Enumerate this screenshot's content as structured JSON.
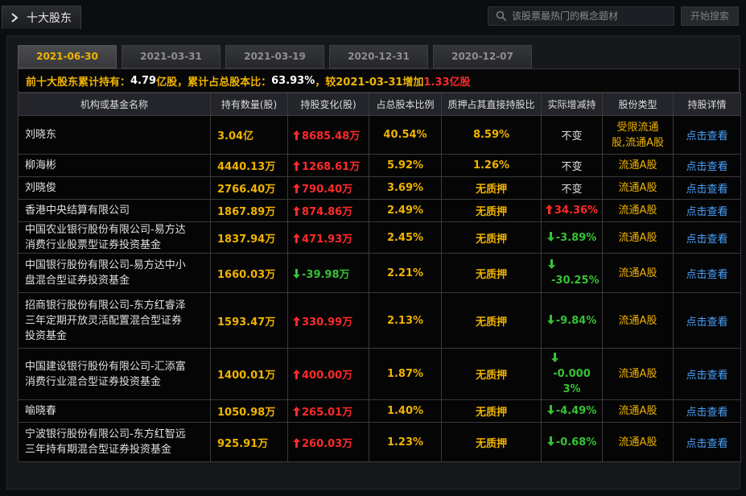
{
  "header": {
    "title": "十大股东",
    "search_placeholder": "该股票最热门的概念题材",
    "search_button": "开始搜索"
  },
  "tabs": [
    "2021-06-30",
    "2021-03-31",
    "2021-03-19",
    "2020-12-31",
    "2020-12-07"
  ],
  "active_tab": 0,
  "summary": {
    "prefix": "前十大股东累计持有：",
    "holding": "4.79",
    "holding_unit": "亿股，累计占总股本比：",
    "ratio": "63.93%",
    "compare": "，较2021-03-31增加",
    "increase": "1.33亿股"
  },
  "columns": [
    "机构或基金名称",
    "持有数量(股)",
    "持股变化(股)",
    "占总股本比例",
    "质押占其直接持股比",
    "实际增减持",
    "股份类型",
    "持股详情"
  ],
  "rows": [
    {
      "name_lines": [
        "刘晓东"
      ],
      "qty": "3.04亿",
      "change": "8685.48万",
      "change_dir": "up",
      "pct": "40.54%",
      "pledge": "8.59%",
      "actual": "不变",
      "actual_dir": "none",
      "type_lines": [
        "受限流通",
        "股,流通A股"
      ],
      "detail": "点击查看"
    },
    {
      "name_lines": [
        "柳海彬"
      ],
      "qty": "4440.13万",
      "change": "1268.61万",
      "change_dir": "up",
      "pct": "5.92%",
      "pledge": "1.26%",
      "actual": "不变",
      "actual_dir": "none",
      "type_lines": [
        "流通A股"
      ],
      "detail": "点击查看"
    },
    {
      "name_lines": [
        "刘晓俊"
      ],
      "qty": "2766.40万",
      "change": "790.40万",
      "change_dir": "up",
      "pct": "3.69%",
      "pledge": "无质押",
      "actual": "不变",
      "actual_dir": "none",
      "type_lines": [
        "流通A股"
      ],
      "detail": "点击查看"
    },
    {
      "name_lines": [
        "香港中央结算有限公司"
      ],
      "qty": "1867.89万",
      "change": "874.86万",
      "change_dir": "up",
      "pct": "2.49%",
      "pledge": "无质押",
      "actual": "34.36%",
      "actual_dir": "up",
      "type_lines": [
        "流通A股"
      ],
      "detail": "点击查看"
    },
    {
      "name_lines": [
        "中国农业银行股份有限公司-易方达",
        "消费行业股票型证券投资基金"
      ],
      "qty": "1837.94万",
      "change": "471.93万",
      "change_dir": "up",
      "pct": "2.45%",
      "pledge": "无质押",
      "actual": "-3.89%",
      "actual_dir": "down",
      "type_lines": [
        "流通A股"
      ],
      "detail": "点击查看"
    },
    {
      "name_lines": [
        "中国银行股份有限公司-易方达中小",
        "盘混合型证券投资基金"
      ],
      "qty": "1660.03万",
      "change": "-39.98万",
      "change_dir": "down",
      "pct": "2.21%",
      "pledge": "无质押",
      "actual": "-30.25%",
      "actual_dir": "down-wrap",
      "type_lines": [
        "流通A股"
      ],
      "detail": "点击查看"
    },
    {
      "name_lines": [
        "招商银行股份有限公司-东方红睿泽",
        "三年定期开放灵活配置混合型证券",
        "投资基金"
      ],
      "qty": "1593.47万",
      "change": "330.99万",
      "change_dir": "up",
      "pct": "2.13%",
      "pledge": "无质押",
      "actual": "-9.84%",
      "actual_dir": "down",
      "type_lines": [
        "流通A股"
      ],
      "detail": "点击查看"
    },
    {
      "name_lines": [
        "中国建设银行股份有限公司-汇添富",
        "消费行业混合型证券投资基金"
      ],
      "qty": "1400.01万",
      "change": "400.00万",
      "change_dir": "up",
      "pct": "1.87%",
      "pledge": "无质押",
      "actual": "-0.0003%",
      "actual_dir": "down-wrap3",
      "type_lines": [
        "流通A股"
      ],
      "detail": "点击查看"
    },
    {
      "name_lines": [
        "喻晓春"
      ],
      "qty": "1050.98万",
      "change": "265.01万",
      "change_dir": "up",
      "pct": "1.40%",
      "pledge": "无质押",
      "actual": "-4.49%",
      "actual_dir": "down",
      "type_lines": [
        "流通A股"
      ],
      "detail": "点击查看"
    },
    {
      "name_lines": [
        "宁波银行股份有限公司-东方红智远",
        "三年持有期混合型证券投资基金"
      ],
      "qty": "925.91万",
      "change": "260.03万",
      "change_dir": "up",
      "pct": "1.23%",
      "pledge": "无质押",
      "actual": "-0.68%",
      "actual_dir": "down",
      "type_lines": [
        "流通A股"
      ],
      "detail": "点击查看"
    }
  ],
  "colors": {
    "up": "#ff2a2a",
    "down": "#36c236",
    "accent": "#f0b400",
    "link": "#4aa3ff"
  },
  "icons": {
    "title": "chevron-right-icon",
    "search": "search-icon",
    "up": "arrow-up-icon",
    "down": "arrow-down-icon"
  }
}
